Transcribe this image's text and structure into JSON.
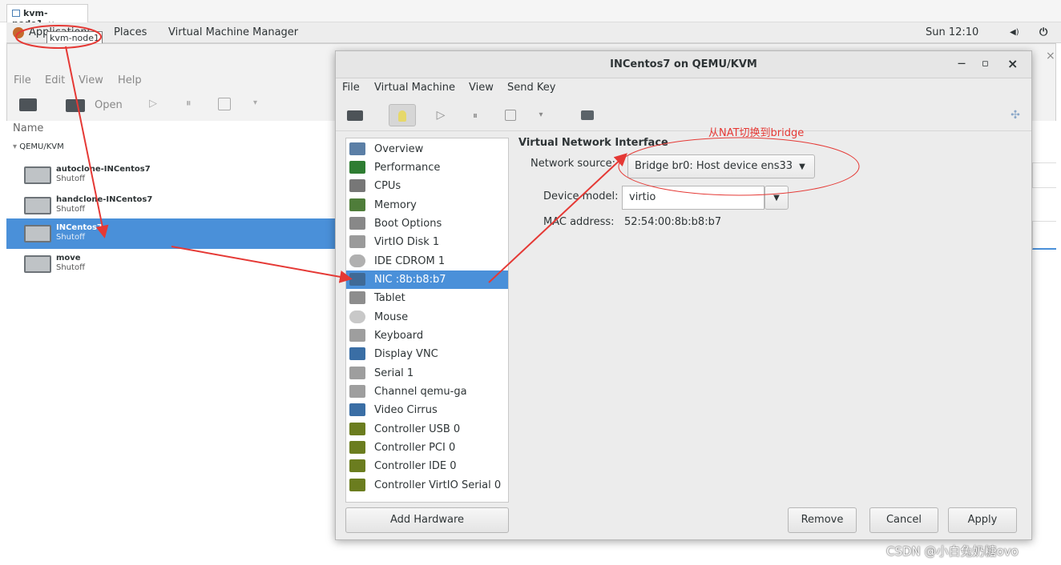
{
  "host": {
    "tab_label": "kvm-node1",
    "tab_close": "×",
    "tooltip": "kvm-node1"
  },
  "topbar": {
    "applications": "Applications",
    "places": "Places",
    "vmm": "Virtual Machine Manager",
    "clock": "Sun 12:10",
    "volume_glyph": "◀)",
    "power_glyph": "⏻"
  },
  "bgwin": {
    "menu": [
      "File",
      "Edit",
      "View",
      "Help"
    ],
    "open_label": "Open",
    "name_header": "Name",
    "group": "QEMU/KVM",
    "vms": [
      {
        "name": "autoclone-INCentos7",
        "status": "Shutoff"
      },
      {
        "name": "handclone-INCentos7",
        "status": "Shutoff"
      },
      {
        "name": "INCentos7",
        "status": "Shutoff"
      },
      {
        "name": "move",
        "status": "Shutoff"
      }
    ],
    "close_glyph": "×"
  },
  "dialog": {
    "title": "INCentos7 on QEMU/KVM",
    "controls": {
      "minimize": "—",
      "maximize": "▫",
      "close": "×"
    },
    "menu": [
      "File",
      "Virtual Machine",
      "View",
      "Send Key"
    ],
    "hardware": [
      {
        "label": "Overview",
        "icon": "monitor-icon",
        "color": "#5b7fa6"
      },
      {
        "label": "Performance",
        "icon": "performance-graph-icon",
        "color": "#2e7d32"
      },
      {
        "label": "CPUs",
        "icon": "cpu-icon",
        "color": "#777777"
      },
      {
        "label": "Memory",
        "icon": "memory-icon",
        "color": "#4f7d3a"
      },
      {
        "label": "Boot Options",
        "icon": "gears-icon",
        "color": "#888888"
      },
      {
        "label": "VirtIO Disk 1",
        "icon": "disk-icon",
        "color": "#9a9a9a"
      },
      {
        "label": "IDE CDROM 1",
        "icon": "cdrom-icon",
        "color": "#b0b0b0"
      },
      {
        "label": "NIC :8b:b8:b7",
        "icon": "network-card-icon",
        "color": "#3f6a96"
      },
      {
        "label": "Tablet",
        "icon": "tablet-icon",
        "color": "#8d8d8d"
      },
      {
        "label": "Mouse",
        "icon": "mouse-icon",
        "color": "#c8c8c8"
      },
      {
        "label": "Keyboard",
        "icon": "keyboard-icon",
        "color": "#9e9e9e"
      },
      {
        "label": "Display VNC",
        "icon": "display-icon",
        "color": "#3a6ea5"
      },
      {
        "label": "Serial 1",
        "icon": "serial-icon",
        "color": "#9e9e9e"
      },
      {
        "label": "Channel qemu-ga",
        "icon": "channel-icon",
        "color": "#9e9e9e"
      },
      {
        "label": "Video Cirrus",
        "icon": "video-icon",
        "color": "#3a6ea5"
      },
      {
        "label": "Controller USB 0",
        "icon": "controller-icon",
        "color": "#6b7d1f"
      },
      {
        "label": "Controller PCI 0",
        "icon": "controller-icon",
        "color": "#6b7d1f"
      },
      {
        "label": "Controller IDE 0",
        "icon": "controller-icon",
        "color": "#6b7d1f"
      },
      {
        "label": "Controller VirtIO Serial 0",
        "icon": "controller-icon",
        "color": "#6b7d1f"
      }
    ],
    "selected_index": 7,
    "add_hardware": "Add Hardware",
    "section_title": "Virtual Network Interface",
    "network_source_label": "Network source:",
    "network_source_value": "Bridge br0: Host device ens33",
    "device_model_label": "Device model:",
    "device_model_value": "virtio",
    "mac_label": "MAC address:",
    "mac_value": "52:54:00:8b:b8:b7",
    "remove": "Remove",
    "cancel": "Cancel",
    "apply": "Apply"
  },
  "annotation": {
    "text": "从NAT切换到bridge",
    "color": "#e53935"
  },
  "watermark": "CSDN @小白兔奶糖ovo"
}
